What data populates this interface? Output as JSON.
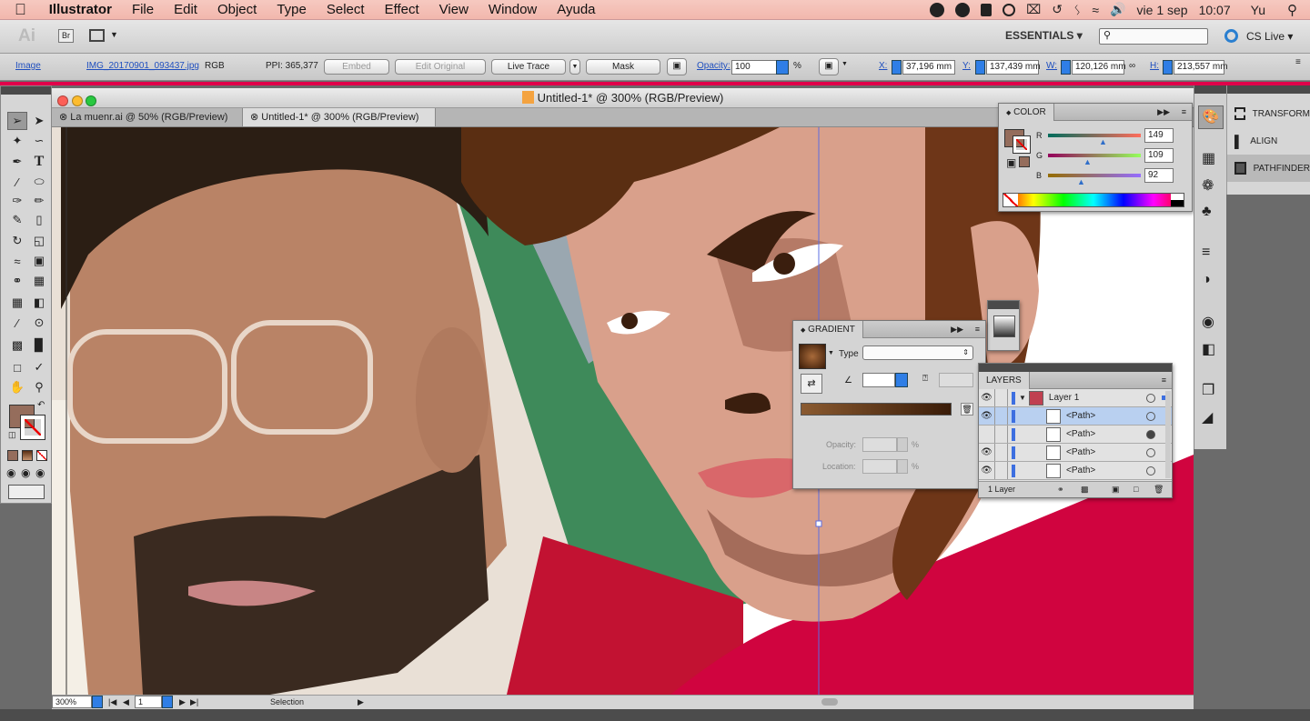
{
  "menubar": {
    "apple": "",
    "app": "Illustrator",
    "items": [
      "File",
      "Edit",
      "Object",
      "Type",
      "Select",
      "Effect",
      "View",
      "Window",
      "Ayuda"
    ],
    "date": "vie 1 sep",
    "time": "10:07",
    "user": "Yu"
  },
  "appbar": {
    "ai_logo": "Ai",
    "bridge": "Br",
    "workspace": "ESSENTIALS",
    "search_placeholder": "",
    "cs_live": "CS Live"
  },
  "control": {
    "type": "Image",
    "file": "IMG_20170901_093437.jpg",
    "mode": "RGB",
    "ppi": "PPI: 365,377",
    "embed": "Embed",
    "edit_original": "Edit Original",
    "live_trace": "Live Trace",
    "mask": "Mask",
    "opacity_label": "Opacity:",
    "opacity": "100",
    "pct": "%",
    "x_label": "X:",
    "x": "37,196 mm",
    "y_label": "Y:",
    "y": "137,439 mm",
    "w_label": "W:",
    "w": "120,126 mm",
    "h_label": "H:",
    "h": "213,557 mm"
  },
  "document": {
    "title": "Untitled-1* @ 300% (RGB/Preview)",
    "tabs": [
      {
        "label": "La muenr.ai @ 50% (RGB/Preview)",
        "close": "⊗"
      },
      {
        "label": "Untitled-1* @ 300% (RGB/Preview)",
        "close": "⊗"
      }
    ]
  },
  "statusbar": {
    "zoom": "300%",
    "page": "1",
    "tool": "Selection"
  },
  "color_panel": {
    "title": "COLOR",
    "r_label": "R",
    "r": "149",
    "g_label": "G",
    "g": "109",
    "b_label": "B",
    "b": "92",
    "fill": "#956d5c"
  },
  "gradient_panel": {
    "title": "GRADIENT",
    "type_label": "Type",
    "type_value": "",
    "opacity_label": "Opacity:",
    "location_label": "Location:",
    "pct": "%"
  },
  "layers_panel": {
    "title": "LAYERS",
    "layer_name": "Layer 1",
    "paths": [
      "<Path>",
      "<Path>",
      "<Path>",
      "<Path>"
    ],
    "footer": "1 Layer"
  },
  "dock": {
    "items": [
      "TRANSFORM",
      "ALIGN",
      "PATHFINDER"
    ]
  },
  "colors": {
    "skin": "#d9a08b",
    "skin_shadow": "#a46c5a",
    "hair": "#5a2e12",
    "shirt": "#d0043f",
    "lips": "#d9676a"
  }
}
